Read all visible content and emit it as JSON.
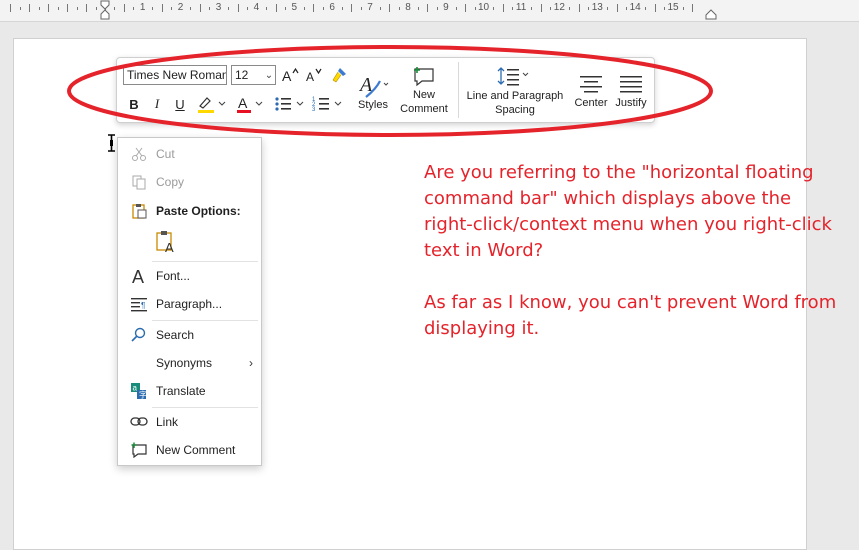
{
  "ruler": {
    "numbers": [
      "1",
      "2",
      "3",
      "4",
      "5",
      "6",
      "7",
      "8",
      "9",
      "10",
      "11",
      "12",
      "13",
      "14",
      "15"
    ]
  },
  "minibar": {
    "font_name": "Times New Roman",
    "font_size": "12",
    "grow_font": "A^",
    "shrink_font": "A˅",
    "bold": "B",
    "italic": "I",
    "underline": "U",
    "styles_label": "Styles",
    "new_comment_label": "New Comment",
    "line_spacing_label": "Line and Paragraph Spacing",
    "center_label": "Center",
    "justify_label": "Justify"
  },
  "context_menu": {
    "cut": "Cut",
    "copy": "Copy",
    "paste_options": "Paste Options:",
    "font": "Font...",
    "paragraph": "Paragraph...",
    "search": "Search",
    "synonyms": "Synonyms",
    "translate": "Translate",
    "link": "Link",
    "new_comment": "New Comment"
  },
  "note": {
    "paragraph1": "Are you referring to the \"horizontal floating command bar\" which displays above the right-click/context menu when you right-click text in Word?",
    "paragraph2": "As far as I know, you can't prevent Word from displaying it."
  },
  "colors": {
    "annotation_red": "#e5232b",
    "highlight_yellow": "#ffd800",
    "font_color_red": "#e81123",
    "icon_blue": "#2b6cb0",
    "icon_teal": "#1a8c7a"
  }
}
